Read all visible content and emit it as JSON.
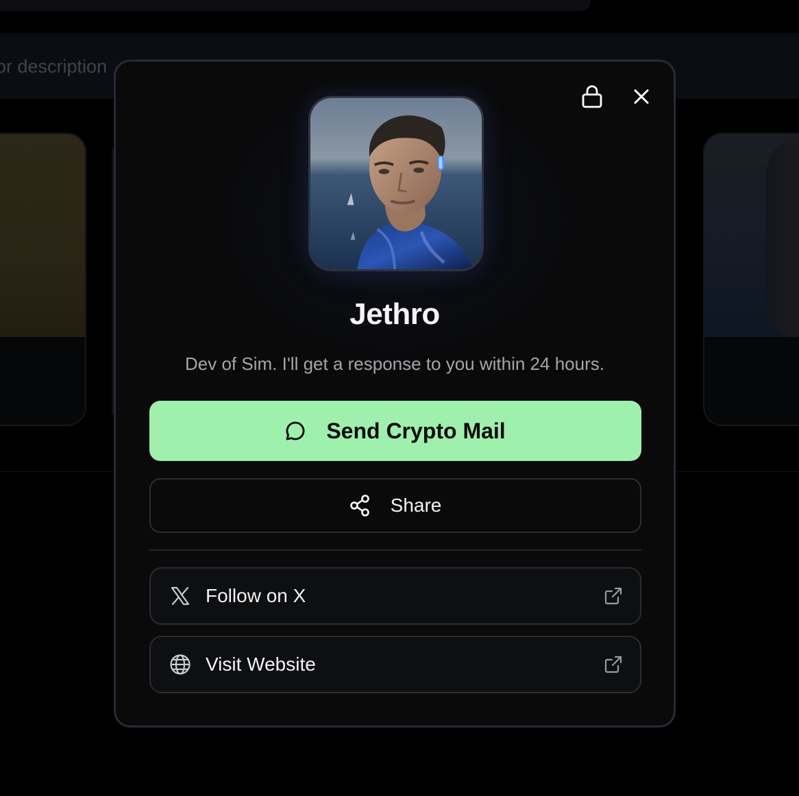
{
  "background": {
    "search_placeholder": "or description"
  },
  "profile_modal": {
    "name": "Jethro",
    "bio": "Dev of Sim. I'll get a response to you within 24 hours.",
    "primary_action": {
      "label": "Send Crypto Mail",
      "icon": "chat-bubble-icon"
    },
    "share_action": {
      "label": "Share",
      "icon": "share-icon"
    },
    "links": [
      {
        "label": "Follow on X",
        "icon": "x-logo-icon",
        "trailing_icon": "external-link-icon"
      },
      {
        "label": "Visit Website",
        "icon": "globe-icon",
        "trailing_icon": "external-link-icon"
      }
    ],
    "header_icons": [
      "lock-icon",
      "close-icon"
    ]
  },
  "colors": {
    "primary_button": "#9ef0ac",
    "modal_bg": "#0a0a0b",
    "modal_border": "#262b35",
    "muted_text": "#a4a6ab"
  }
}
